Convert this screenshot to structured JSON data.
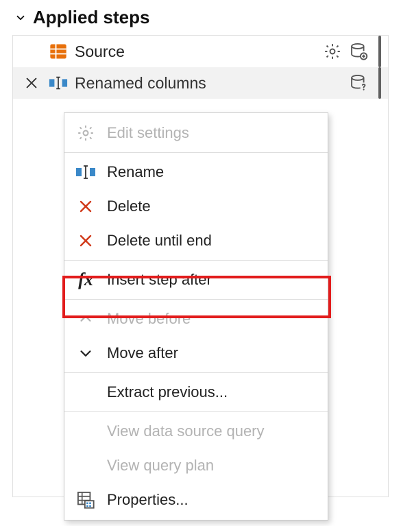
{
  "section": {
    "title": "Applied steps"
  },
  "steps": [
    {
      "label": "Source"
    },
    {
      "label": "Renamed columns"
    }
  ],
  "contextMenu": {
    "editSettings": "Edit settings",
    "rename": "Rename",
    "delete": "Delete",
    "deleteUntilEnd": "Delete until end",
    "insertStepAfter": "Insert step after",
    "moveBefore": "Move before",
    "moveAfter": "Move after",
    "extractPrevious": "Extract previous...",
    "viewDataSourceQuery": "View data source query",
    "viewQueryPlan": "View query plan",
    "properties": "Properties..."
  }
}
